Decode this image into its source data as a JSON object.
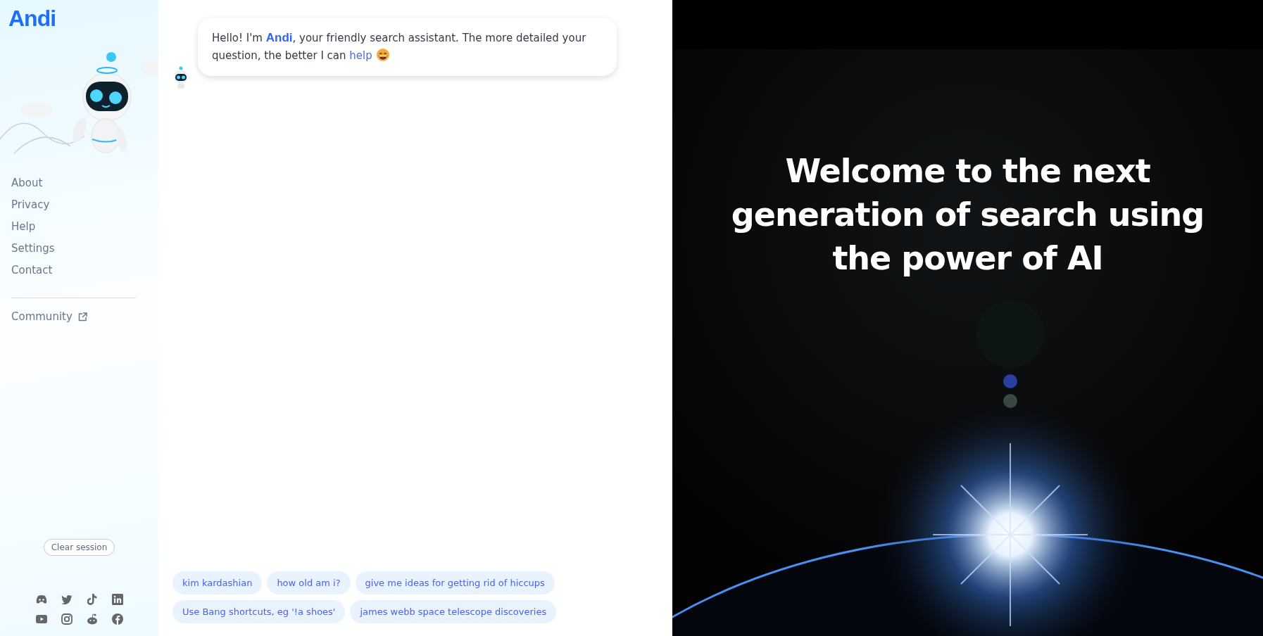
{
  "sidebar": {
    "logo": "Andi",
    "nav": [
      {
        "label": "About"
      },
      {
        "label": "Privacy"
      },
      {
        "label": "Help"
      },
      {
        "label": "Settings"
      },
      {
        "label": "Contact"
      }
    ],
    "community": {
      "label": "Community"
    },
    "clear_button": "Clear session",
    "social": [
      {
        "kind": "discord"
      },
      {
        "kind": "twitter"
      },
      {
        "kind": "tiktok"
      },
      {
        "kind": "linkedin"
      },
      {
        "kind": "youtube"
      },
      {
        "kind": "instagram"
      },
      {
        "kind": "reddit"
      },
      {
        "kind": "facebook"
      }
    ]
  },
  "message": {
    "parts": [
      {
        "kind": "plain",
        "text": "Hello! I'm "
      },
      {
        "kind": "name",
        "text": "Andi"
      },
      {
        "kind": "plain",
        "text": ", your friendly search assistant. The more detailed your question, the better I can "
      },
      {
        "kind": "link",
        "text": "help"
      }
    ]
  },
  "suggestions": [
    {
      "label": "kim kardashian"
    },
    {
      "label": "how old am i?"
    },
    {
      "label": "give me ideas for getting rid of hiccups"
    },
    {
      "label": "Use Bang shortcuts, eg '!a shoes'"
    },
    {
      "label": "james webb space telescope discoveries"
    }
  ],
  "hero": {
    "heading": "Welcome to the next generation of search using the power of AI"
  }
}
